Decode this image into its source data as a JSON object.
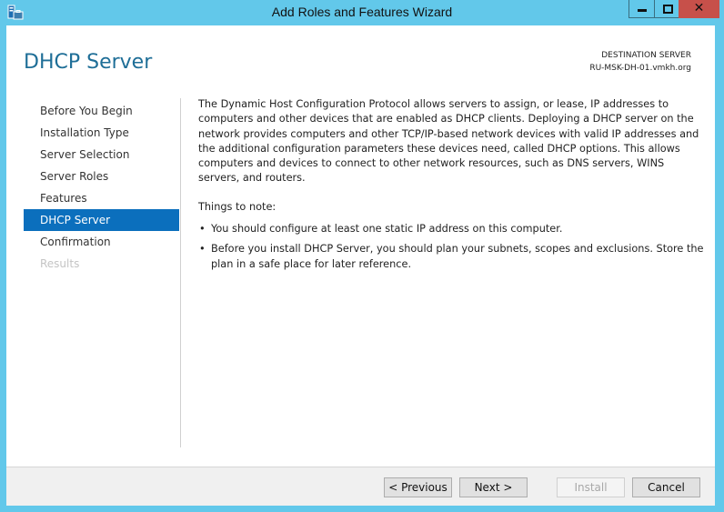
{
  "window": {
    "title": "Add Roles and Features Wizard",
    "controls": {
      "minimize": "minimize",
      "maximize": "maximize",
      "close": "✕"
    }
  },
  "header": {
    "page_title": "DHCP Server",
    "destination_label": "DESTINATION SERVER",
    "destination_server": "RU-MSK-DH-01.vmkh.org"
  },
  "nav": {
    "items": [
      {
        "label": "Before You Begin",
        "state": "normal"
      },
      {
        "label": "Installation Type",
        "state": "normal"
      },
      {
        "label": "Server Selection",
        "state": "normal"
      },
      {
        "label": "Server Roles",
        "state": "normal"
      },
      {
        "label": "Features",
        "state": "normal"
      },
      {
        "label": "DHCP Server",
        "state": "active"
      },
      {
        "label": "Confirmation",
        "state": "normal"
      },
      {
        "label": "Results",
        "state": "disabled"
      }
    ]
  },
  "content": {
    "description": "The Dynamic Host Configuration Protocol allows servers to assign, or lease, IP addresses to computers and other devices that are enabled as DHCP clients. Deploying a DHCP server on the network provides computers and other TCP/IP-based network devices with valid IP addresses and the additional configuration parameters these devices need, called DHCP options. This allows computers and devices to connect to other network resources, such as DNS servers, WINS servers, and routers.",
    "notes_heading": "Things to note:",
    "notes": [
      "You should configure at least one static IP address on this computer.",
      "Before you install DHCP Server, you should plan your subnets, scopes and exclusions. Store the plan in a safe place for later reference."
    ]
  },
  "footer": {
    "previous": "< Previous",
    "next": "Next >",
    "install": "Install",
    "cancel": "Cancel"
  },
  "colors": {
    "frame": "#62c8ea",
    "accent_title": "#1e6e97",
    "nav_active": "#0b6fbd",
    "close_button": "#c7504a"
  }
}
